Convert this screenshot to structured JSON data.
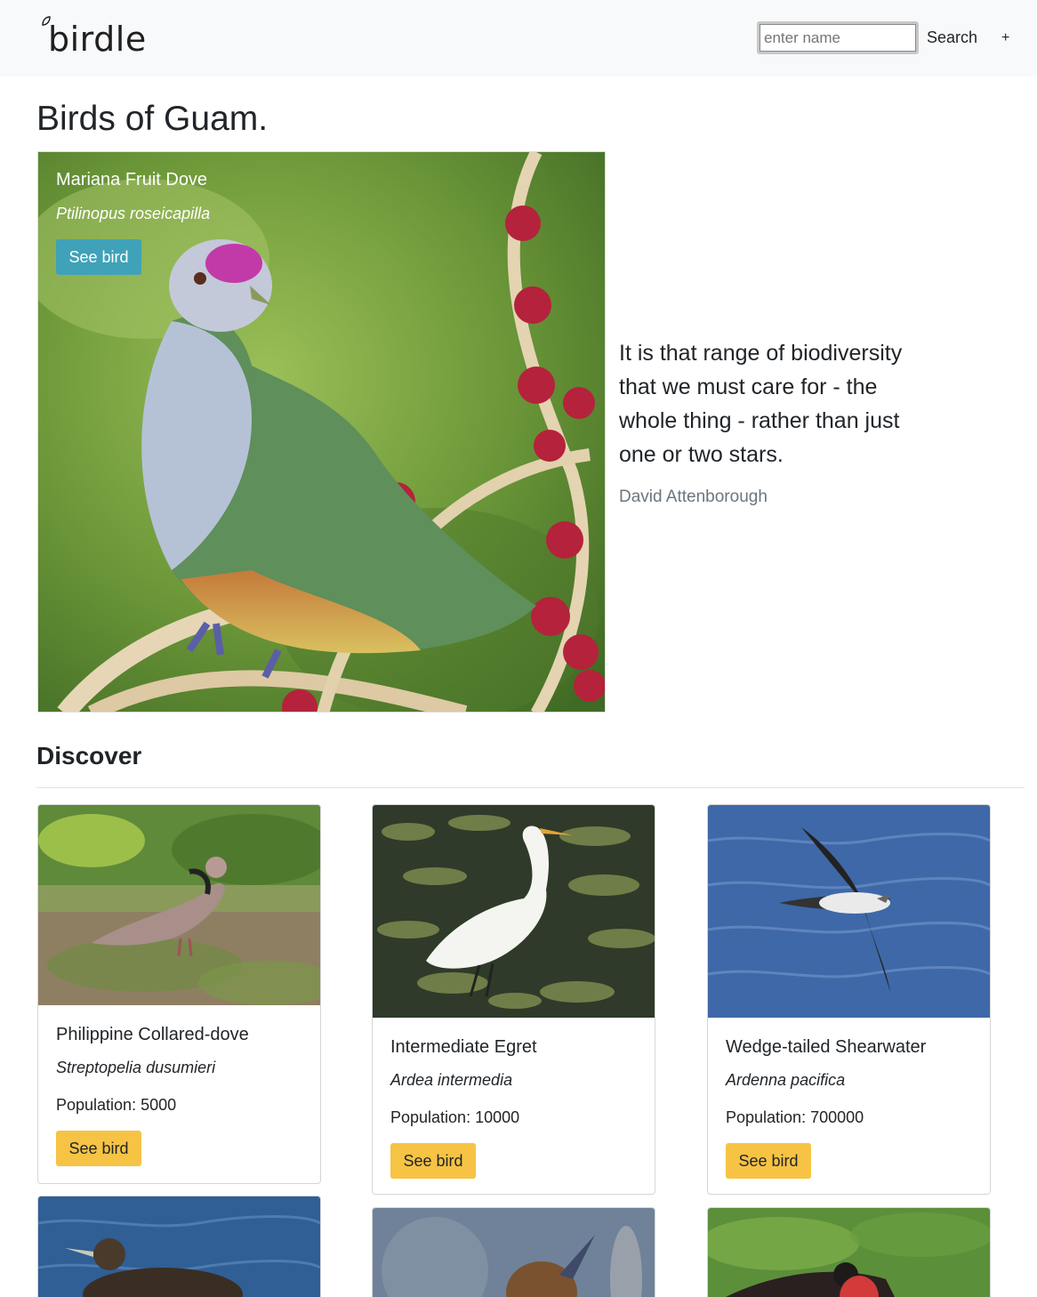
{
  "navbar": {
    "brand": "birdle",
    "search_placeholder": "enter name",
    "search_label": "Search",
    "add_label": "+"
  },
  "page": {
    "title": "Birds of Guam."
  },
  "featured": {
    "name": "Mariana Fruit Dove",
    "scientific_name": "Ptilinopus roseicapilla",
    "button_label": "See bird"
  },
  "quote": {
    "text": "It is that range of biodiversity that we must care for - the whole thing - rather than just one or two stars.",
    "author": "David Attenborough"
  },
  "discover": {
    "title": "Discover",
    "cards": [
      {
        "name": "Philippine Collared-dove",
        "scientific_name": "Streptopelia dusumieri",
        "population": "Population: 5000",
        "button_label": "See bird"
      },
      {
        "name": "Intermediate Egret",
        "scientific_name": "Ardea intermedia",
        "population": "Population: 10000",
        "button_label": "See bird"
      },
      {
        "name": "Wedge-tailed Shearwater",
        "scientific_name": "Ardenna pacifica",
        "population": "Population: 700000",
        "button_label": "See bird"
      }
    ]
  },
  "colors": {
    "navbar_bg": "#f8f9fa",
    "info_button": "#3fa2b8",
    "warning_button": "#f6c344",
    "muted_text": "#6c757d"
  }
}
